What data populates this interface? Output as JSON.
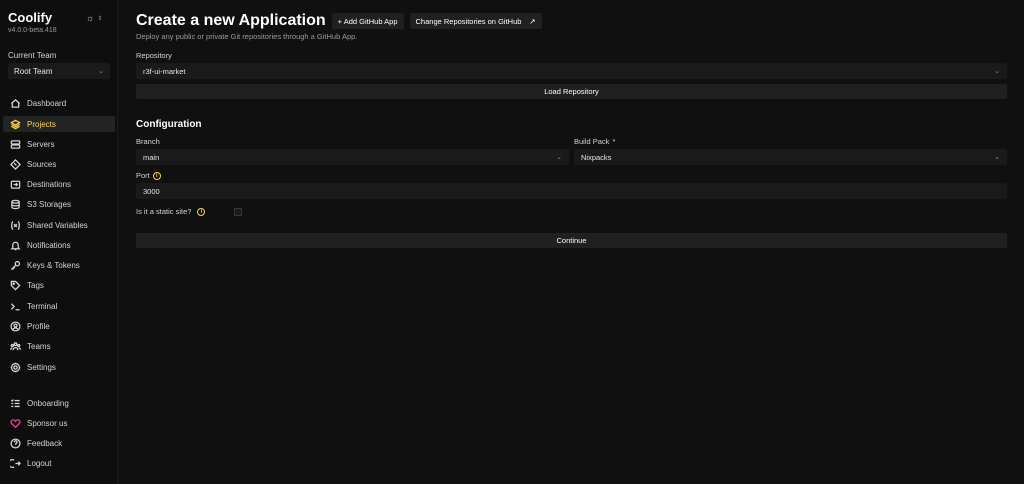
{
  "brand": {
    "name": "Coolify",
    "version": "v4.0.0-beta.418"
  },
  "theme_toggle": {
    "icon": "sun-icon"
  },
  "team": {
    "label": "Current Team",
    "selected": "Root Team"
  },
  "sidebar": {
    "items": [
      {
        "label": "Dashboard",
        "icon": "home-icon"
      },
      {
        "label": "Projects",
        "icon": "layers-icon",
        "active": true
      },
      {
        "label": "Servers",
        "icon": "server-icon"
      },
      {
        "label": "Sources",
        "icon": "git-icon"
      },
      {
        "label": "Destinations",
        "icon": "destination-icon"
      },
      {
        "label": "S3 Storages",
        "icon": "database-icon"
      },
      {
        "label": "Shared Variables",
        "icon": "variable-icon"
      },
      {
        "label": "Notifications",
        "icon": "bell-icon"
      },
      {
        "label": "Keys & Tokens",
        "icon": "key-icon"
      },
      {
        "label": "Tags",
        "icon": "tag-icon"
      },
      {
        "label": "Terminal",
        "icon": "terminal-icon"
      },
      {
        "label": "Profile",
        "icon": "user-icon"
      },
      {
        "label": "Teams",
        "icon": "users-icon"
      },
      {
        "label": "Settings",
        "icon": "gear-icon"
      }
    ],
    "footer": [
      {
        "label": "Onboarding",
        "icon": "checklist-icon"
      },
      {
        "label": "Sponsor us",
        "icon": "heart-icon"
      },
      {
        "label": "Feedback",
        "icon": "help-icon"
      },
      {
        "label": "Logout",
        "icon": "logout-icon"
      }
    ]
  },
  "header": {
    "title": "Create a new Application",
    "add_app_label": "+ Add GitHub App",
    "change_repos_label": "Change Repositories on GitHub",
    "change_repos_icon": "↗",
    "subtitle": "Deploy any public or private Git repositories through a GitHub App."
  },
  "repository": {
    "label": "Repository",
    "value": "r3f-ui-market",
    "load_label": "Load Repository"
  },
  "configuration": {
    "title": "Configuration",
    "branch": {
      "label": "Branch",
      "value": "main"
    },
    "build_pack": {
      "label": "Build Pack",
      "required_mark": "*",
      "value": "Nixpacks"
    },
    "port": {
      "label": "Port",
      "value": "3000"
    },
    "static_site": {
      "label": "Is it a static site?",
      "checked": false
    },
    "continue_label": "Continue"
  },
  "colors": {
    "accent": "#fcd34d",
    "background": "#101010",
    "field": "#1a1a1a",
    "sponsor": "#ec4899"
  }
}
